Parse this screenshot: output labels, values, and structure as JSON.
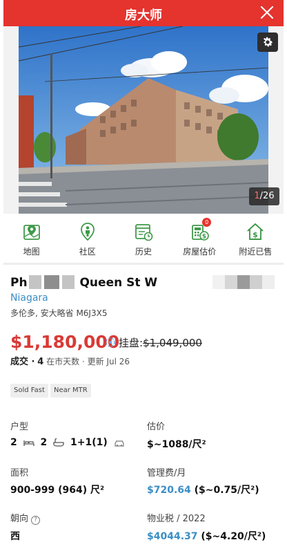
{
  "app": {
    "title": "房大师"
  },
  "photo": {
    "counter_current": "1",
    "counter_total": "/26"
  },
  "actions": [
    {
      "label": "地图",
      "icon": "map-pin-icon"
    },
    {
      "label": "社区",
      "icon": "location-person-icon"
    },
    {
      "label": "历史",
      "icon": "history-calendar-icon"
    },
    {
      "label": "房屋估价",
      "icon": "valuation-calculator-icon",
      "badge": "0"
    },
    {
      "label": "附近已售",
      "icon": "house-dollar-icon"
    }
  ],
  "listing": {
    "address_prefix": "Ph",
    "address_suffix": "Queen St W",
    "area": "Niagara",
    "city": "多伦多, 安大略省 M6J3X5",
    "price": "$1,180,000",
    "list_label": "挂盘:",
    "list_price": "$1,049,000",
    "status": "成交 ·",
    "days": "4",
    "days_label": "在市天数",
    "updated": "· 更新 Jul 26"
  },
  "tags": [
    "Sold Fast",
    "Near MTR"
  ],
  "specs": {
    "type_label": "户型",
    "beds": "2",
    "baths": "2",
    "parking": "1+1(1)",
    "estimate_label": "估价",
    "estimate_value": "$~1088/尺²",
    "size_label": "面积",
    "size_value": "900-999 (964) 尺²",
    "fee_label": "管理费/月",
    "fee_value": "$720.64",
    "fee_sub": "($~0.75/尺²)",
    "facing_label": "朝向",
    "facing_value": "西",
    "tax_label": "物业税 / 2022",
    "tax_value": "$4044.37",
    "tax_sub": "($~4.20/尺²)"
  },
  "colors": {
    "brand": "#e5332e",
    "price": "#d93a36",
    "link": "#3a8ec6",
    "icon_green": "#3f9a4a"
  }
}
